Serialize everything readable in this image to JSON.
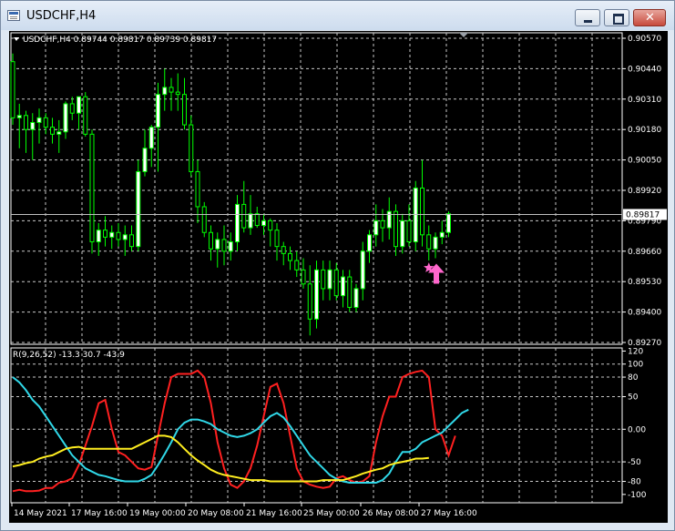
{
  "window": {
    "title": "USDCHF,H4"
  },
  "chart_data": [
    {
      "type": "candlestick",
      "info_text": "USDCHF,H4 0.89744 0.89817 0.89739 0.89817",
      "price_ticks": [
        "0.90570",
        "0.90440",
        "0.90310",
        "0.90180",
        "0.90050",
        "0.89920",
        "0.89790",
        "0.89660",
        "0.89530",
        "0.89400",
        "0.89270"
      ],
      "ylim": [
        0.8927,
        0.9057
      ],
      "current_price": 0.89817,
      "current_price_label": "0.89817",
      "bull_color": "#00ff00",
      "bear_color": "#00ff00",
      "bull_fill": "#ffffff",
      "bear_fill": "#000000",
      "candles": [
        [
          0.9047,
          0.90505,
          0.902,
          0.9023
        ],
        [
          0.9023,
          0.9029,
          0.901,
          0.9024
        ],
        [
          0.9024,
          0.9026,
          0.9008,
          0.9018
        ],
        [
          0.9018,
          0.9025,
          0.9005,
          0.9021
        ],
        [
          0.9021,
          0.9027,
          0.9012,
          0.9023
        ],
        [
          0.9023,
          0.9025,
          0.9016,
          0.9019
        ],
        [
          0.9019,
          0.9023,
          0.9012,
          0.9016
        ],
        [
          0.9016,
          0.9022,
          0.9008,
          0.9017
        ],
        [
          0.9017,
          0.903,
          0.9014,
          0.9029
        ],
        [
          0.9029,
          0.9032,
          0.9022,
          0.9025
        ],
        [
          0.9025,
          0.9031,
          0.9018,
          0.9032
        ],
        [
          0.9032,
          0.9034,
          0.9015,
          0.9016
        ],
        [
          0.9016,
          0.9018,
          0.8965,
          0.897
        ],
        [
          0.897,
          0.8978,
          0.8964,
          0.8975
        ],
        [
          0.8975,
          0.8981,
          0.8968,
          0.8972
        ],
        [
          0.8972,
          0.8977,
          0.8967,
          0.8974
        ],
        [
          0.8974,
          0.8978,
          0.8968,
          0.8971
        ],
        [
          0.8971,
          0.8977,
          0.8964,
          0.8973
        ],
        [
          0.8973,
          0.8977,
          0.8966,
          0.8968
        ],
        [
          0.8968,
          0.9005,
          0.8966,
          0.9
        ],
        [
          0.9,
          0.9018,
          0.8998,
          0.901
        ],
        [
          0.901,
          0.902,
          0.9002,
          0.9019
        ],
        [
          0.9019,
          0.9038,
          0.9,
          0.9033
        ],
        [
          0.9033,
          0.9044,
          0.9026,
          0.9036
        ],
        [
          0.9036,
          0.904,
          0.9026,
          0.9034
        ],
        [
          0.9034,
          0.9042,
          0.9026,
          0.9033
        ],
        [
          0.9033,
          0.904,
          0.9018,
          0.902
        ],
        [
          0.902,
          0.9024,
          0.8998,
          0.9
        ],
        [
          0.9,
          0.9005,
          0.8978,
          0.8985
        ],
        [
          0.8985,
          0.8987,
          0.8972,
          0.8974
        ],
        [
          0.8974,
          0.8977,
          0.8962,
          0.8967
        ],
        [
          0.8967,
          0.8974,
          0.8959,
          0.8971
        ],
        [
          0.8971,
          0.8977,
          0.896,
          0.8966
        ],
        [
          0.8966,
          0.8974,
          0.8962,
          0.897
        ],
        [
          0.897,
          0.899,
          0.8966,
          0.8986
        ],
        [
          0.8986,
          0.8996,
          0.8974,
          0.8976
        ],
        [
          0.8976,
          0.899,
          0.8973,
          0.8982
        ],
        [
          0.8982,
          0.8985,
          0.8976,
          0.8977
        ],
        [
          0.8977,
          0.8982,
          0.8973,
          0.8979
        ],
        [
          0.8979,
          0.898,
          0.8968,
          0.8975
        ],
        [
          0.8975,
          0.8978,
          0.8962,
          0.8968
        ],
        [
          0.8968,
          0.897,
          0.896,
          0.8965
        ],
        [
          0.8965,
          0.8968,
          0.8958,
          0.8962
        ],
        [
          0.8962,
          0.8966,
          0.8955,
          0.8958
        ],
        [
          0.8958,
          0.8963,
          0.895,
          0.8952
        ],
        [
          0.8952,
          0.896,
          0.893,
          0.8937
        ],
        [
          0.8937,
          0.8962,
          0.8933,
          0.8958
        ],
        [
          0.8958,
          0.8962,
          0.8945,
          0.895
        ],
        [
          0.895,
          0.8962,
          0.8945,
          0.8958
        ],
        [
          0.8958,
          0.8961,
          0.8945,
          0.8947
        ],
        [
          0.8947,
          0.8958,
          0.8942,
          0.8955
        ],
        [
          0.8955,
          0.8958,
          0.894,
          0.8942
        ],
        [
          0.8942,
          0.8952,
          0.894,
          0.895
        ],
        [
          0.895,
          0.897,
          0.8945,
          0.8966
        ],
        [
          0.8966,
          0.8975,
          0.8961,
          0.8973
        ],
        [
          0.8973,
          0.8986,
          0.8968,
          0.8979
        ],
        [
          0.8979,
          0.8984,
          0.897,
          0.8976
        ],
        [
          0.8976,
          0.8989,
          0.8971,
          0.8983
        ],
        [
          0.8983,
          0.8986,
          0.8964,
          0.8968
        ],
        [
          0.8968,
          0.8982,
          0.8965,
          0.8979
        ],
        [
          0.8979,
          0.8986,
          0.8968,
          0.897
        ],
        [
          0.897,
          0.8996,
          0.8966,
          0.8993
        ],
        [
          0.8993,
          0.9005,
          0.8968,
          0.8973
        ],
        [
          0.8973,
          0.8977,
          0.8962,
          0.8967
        ],
        [
          0.8967,
          0.8974,
          0.8963,
          0.8972
        ],
        [
          0.8972,
          0.8979,
          0.8969,
          0.8974
        ],
        [
          0.8974,
          0.8983,
          0.8972,
          0.8982
        ]
      ],
      "annotations": {
        "star_color": "#ff66cc",
        "arrow_color": "#ff66cc",
        "star_candle": 63,
        "arrow_candle": 64
      }
    },
    {
      "type": "line",
      "info_text": "R(9,26,52) -13.3 30.7 -43.9",
      "ticks": [
        "120",
        "100",
        "80",
        "50",
        "0.00",
        "-50",
        "-80",
        "-100"
      ],
      "tick_values": [
        120,
        100,
        80,
        50,
        0,
        -50,
        -80,
        -100
      ],
      "ylim": [
        -110,
        122
      ],
      "series": [
        {
          "color": "#ff2020",
          "values": [
            -95,
            -93,
            -95,
            -95,
            -94,
            -90,
            -90,
            -82,
            -80,
            -75,
            -55,
            -25,
            5,
            40,
            45,
            0,
            -35,
            -40,
            -50,
            -60,
            -62,
            -58,
            -10,
            40,
            80,
            85,
            85,
            85,
            90,
            80,
            40,
            -20,
            -60,
            -85,
            -90,
            -80,
            -60,
            -25,
            20,
            65,
            70,
            40,
            -10,
            -60,
            -80,
            -85,
            -88,
            -90,
            -88,
            -75,
            -72,
            -78,
            -82,
            -80,
            -72,
            -20,
            20,
            50,
            50,
            80,
            85,
            88,
            90,
            80,
            0,
            -10,
            -40,
            -10
          ],
          "text": "-13.3"
        },
        {
          "color": "#30d8e8",
          "values": [
            80,
            72,
            60,
            45,
            35,
            20,
            5,
            -10,
            -25,
            -40,
            -50,
            -60,
            -65,
            -70,
            -72,
            -75,
            -78,
            -80,
            -80,
            -80,
            -76,
            -70,
            -55,
            -38,
            -20,
            0,
            10,
            15,
            15,
            12,
            8,
            0,
            -5,
            -10,
            -12,
            -10,
            -6,
            0,
            10,
            20,
            25,
            18,
            5,
            -10,
            -25,
            -40,
            -50,
            -60,
            -70,
            -76,
            -80,
            -82,
            -82,
            -82,
            -82,
            -82,
            -78,
            -68,
            -50,
            -35,
            -35,
            -30,
            -20,
            -15,
            -10,
            -5,
            5,
            15,
            25,
            30
          ],
          "text": "30.7"
        },
        {
          "color": "#ffee20",
          "values": [
            -57,
            -55,
            -52,
            -50,
            -45,
            -42,
            -40,
            -35,
            -30,
            -28,
            -27,
            -30,
            -30,
            -30,
            -30,
            -30,
            -30,
            -30,
            -30,
            -25,
            -20,
            -15,
            -10,
            -10,
            -12,
            -20,
            -30,
            -40,
            -48,
            -55,
            -62,
            -67,
            -70,
            -72,
            -74,
            -76,
            -78,
            -78,
            -78,
            -80,
            -80,
            -80,
            -80,
            -80,
            -80,
            -80,
            -80,
            -78,
            -78,
            -78,
            -78,
            -75,
            -72,
            -68,
            -65,
            -62,
            -60,
            -55,
            -52,
            -50,
            -48,
            -45,
            -45,
            -44
          ],
          "text": "-43.9"
        }
      ]
    }
  ],
  "x_axis_labels": [
    "14 May 2021",
    "17 May 16:00",
    "19 May 00:00",
    "20 May 08:00",
    "21 May 16:00",
    "25 May 00:00",
    "26 May 08:00",
    "27 May 16:00"
  ]
}
